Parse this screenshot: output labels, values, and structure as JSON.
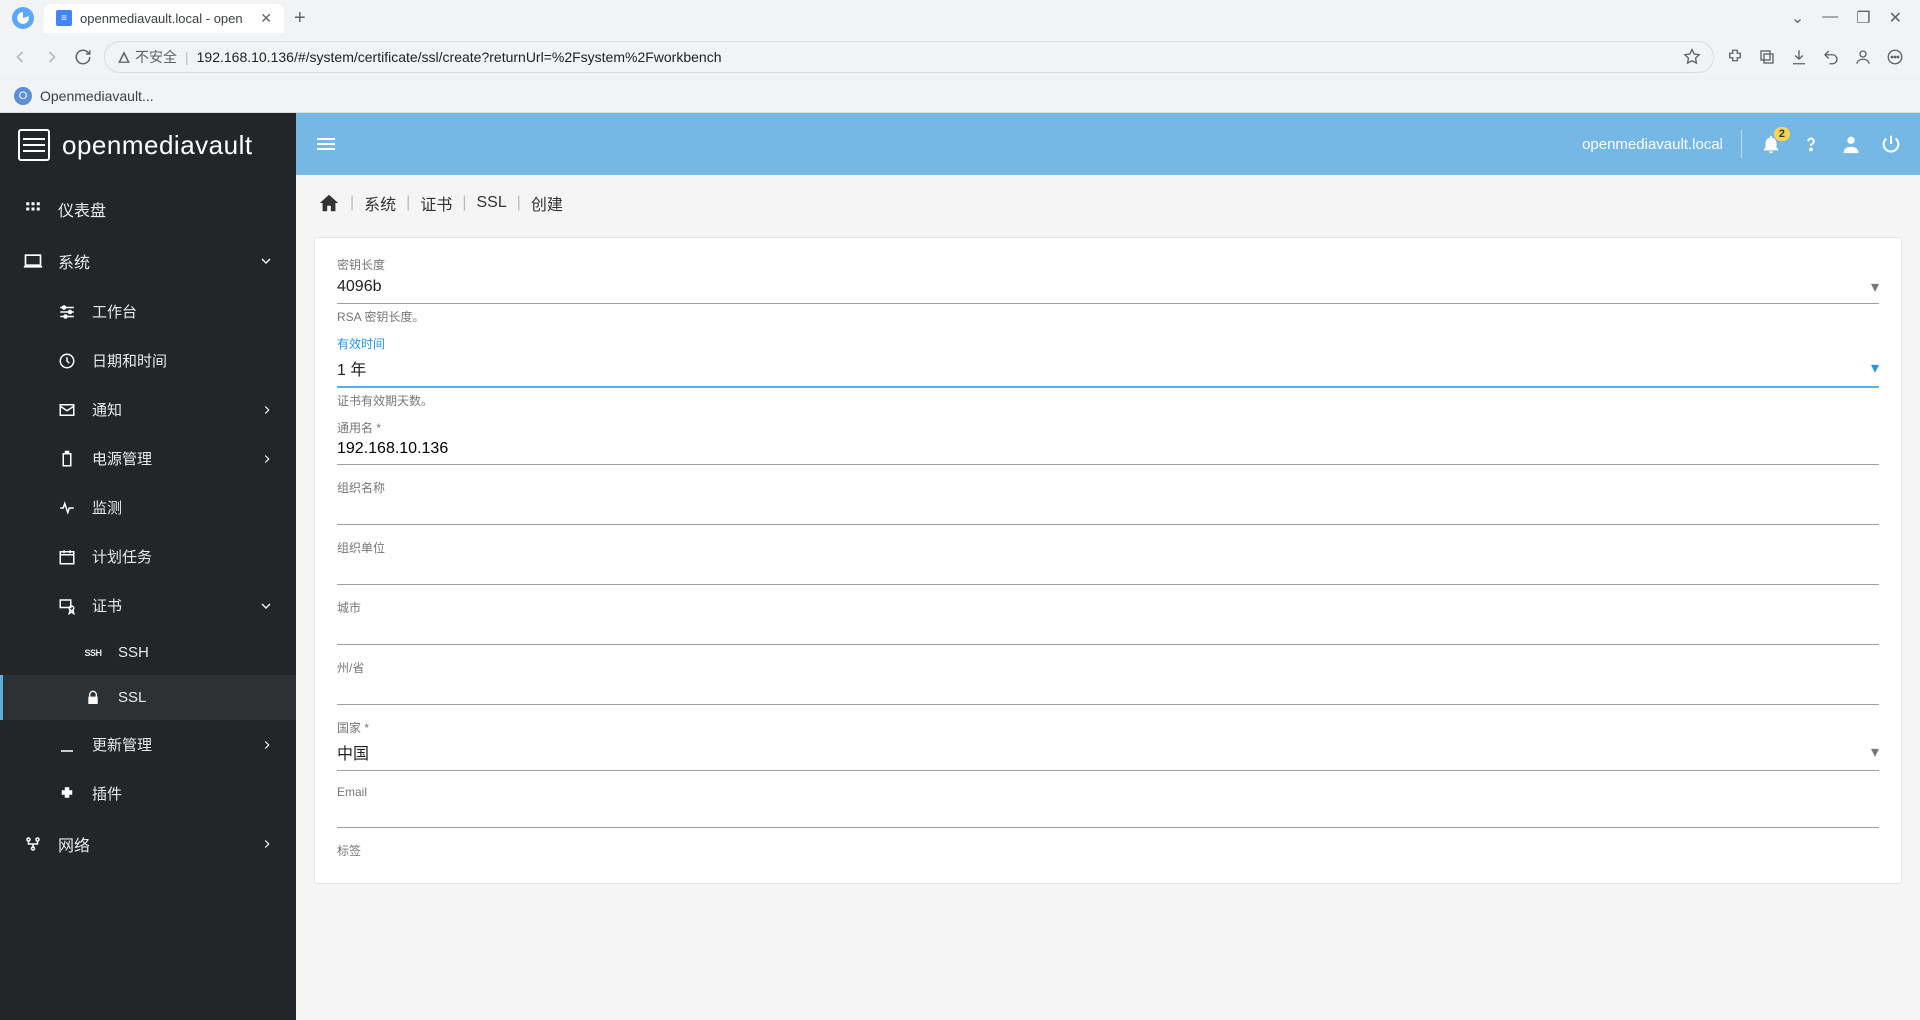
{
  "browser": {
    "tab_title": "openmediavault.local - open",
    "insecure_label": "不安全",
    "url": "192.168.10.136/#/system/certificate/ssl/create?returnUrl=%2Fsystem%2Fworkbench",
    "bookmark": "Openmediavault..."
  },
  "topbar": {
    "hostname": "openmediavault.local",
    "notification_count": "2"
  },
  "logo_text": "openmediavault",
  "sidebar": {
    "dashboard": "仪表盘",
    "system": "系统",
    "workbench": "工作台",
    "datetime": "日期和时间",
    "notification": "通知",
    "power": "电源管理",
    "monitor": "监测",
    "schedule": "计划任务",
    "cert": "证书",
    "ssh": "SSH",
    "ssl": "SSL",
    "update": "更新管理",
    "plugins": "插件",
    "network": "网络"
  },
  "breadcrumb": {
    "system": "系统",
    "cert": "证书",
    "ssl": "SSL",
    "create": "创建"
  },
  "form": {
    "keylen_label": "密钥长度",
    "keylen_value": "4096b",
    "keylen_hint": "RSA 密钥长度。",
    "valid_label": "有效时间",
    "valid_value": "1 年",
    "valid_hint": "证书有效期天数。",
    "cn_label": "通用名 *",
    "cn_value": "192.168.10.136",
    "org_label": "组织名称",
    "ou_label": "组织单位",
    "city_label": "城市",
    "state_label": "州/省",
    "country_label": "国家 *",
    "country_value": "中国",
    "email_label": "Email",
    "tag_label": "标签"
  }
}
